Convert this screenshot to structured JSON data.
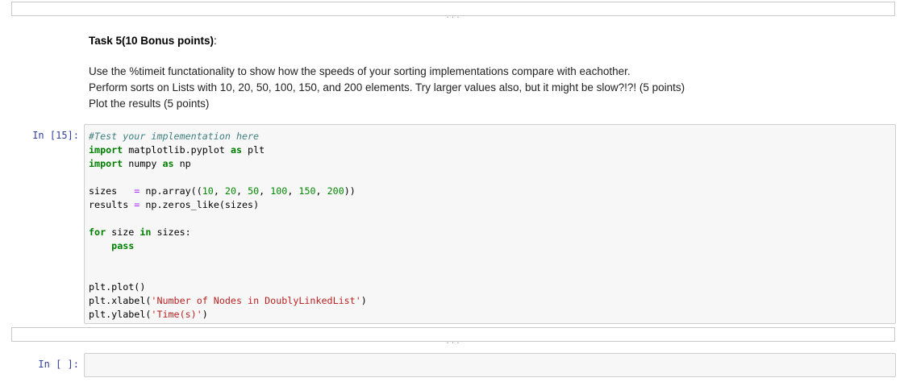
{
  "collapsed_top": {
    "dots": "..."
  },
  "task": {
    "title_main": "Task 5(10 Bonus points)",
    "title_colon": ":",
    "lines": [
      "Use the %timeit functationality to show how the speeds of your sorting implementations compare with eachother.",
      "Perform sorts on Lists with 10, 20, 50, 100, 150, and 200 elements. Try larger values also, but it might be slow?!?! (5 points)",
      "Plot the results (5 points)"
    ]
  },
  "code_cell": {
    "prompt": "In  [15]:",
    "comment": "#Test your implementation here",
    "line_import_plt": {
      "kw1": "import",
      "mod": " matplotlib.pyplot ",
      "kw2": "as",
      "alias": " plt"
    },
    "line_import_np": {
      "kw1": "import",
      "mod": " numpy ",
      "kw2": "as",
      "alias": " np"
    },
    "line_sizes": {
      "name": "sizes   ",
      "eq": "=",
      "call": " np.array((",
      "nums": [
        "10",
        "20",
        "50",
        "100",
        "150",
        "200"
      ],
      "end": "))"
    },
    "line_results": {
      "name": "results ",
      "eq": "=",
      "call": " np.zeros_like(sizes)"
    },
    "line_for": {
      "kw1": "for",
      "var": " size ",
      "kw2": "in",
      "rest": " sizes:"
    },
    "line_pass": {
      "indent": "    ",
      "kw": "pass"
    },
    "line_plot": "plt.plot()",
    "line_xlabel": {
      "pre": "plt.xlabel(",
      "str": "'Number of Nodes in DoublyLinkedList'",
      "post": ")"
    },
    "line_ylabel": {
      "pre": "plt.ylabel(",
      "str": "'Time(s)'",
      "post": ")"
    }
  },
  "collapsed_mid": {
    "dots": "..."
  },
  "empty_cell": {
    "prompt": "In  [ ]:"
  }
}
